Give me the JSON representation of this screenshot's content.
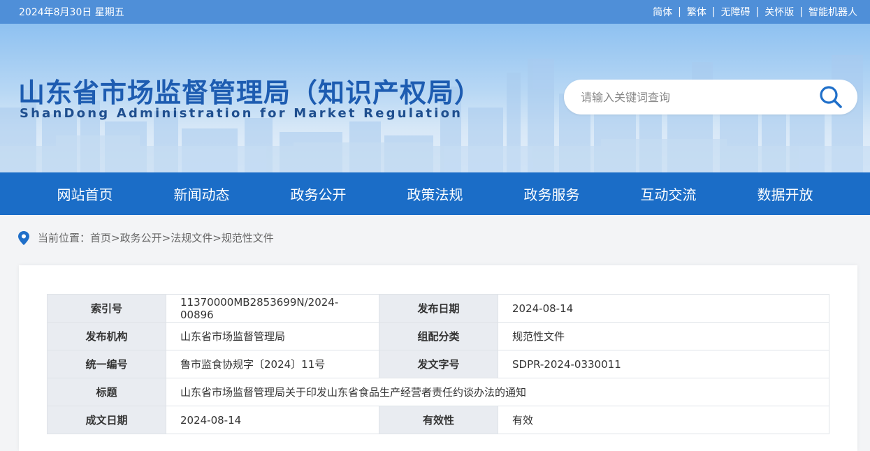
{
  "topbar": {
    "date": "2024年8月30日 星期五",
    "links": [
      "简体",
      "繁体",
      "无障碍",
      "关怀版",
      "智能机器人"
    ],
    "separator": "|"
  },
  "header": {
    "title_cn": "山东省市场监督管理局（知识产权局）",
    "title_en": "ShanDong Administration for Market Regulation",
    "search_placeholder": "请输入关键词查询",
    "search_icon": "search-icon"
  },
  "nav": {
    "items": [
      "网站首页",
      "新闻动态",
      "政务公开",
      "政策法规",
      "政务服务",
      "互动交流",
      "数据开放"
    ]
  },
  "breadcrumb": {
    "prefix": "当前位置：",
    "items": [
      "首页",
      "政务公开",
      "法规文件",
      "规范性文件"
    ],
    "separator": ">"
  },
  "info": {
    "index_label": "索引号",
    "index_value": "11370000MB2853699N/2024-00896",
    "pubdate_label": "发布日期",
    "pubdate_value": "2024-08-14",
    "org_label": "发布机构",
    "org_value": "山东省市场监督管理局",
    "category_label": "组配分类",
    "category_value": "规范性文件",
    "serial_label": "统一编号",
    "serial_value": "鲁市监食协规字〔2024〕11号",
    "docno_label": "发文字号",
    "docno_value": "SDPR-2024-0330011",
    "title_label": "标题",
    "title_value": "山东省市场监督管理局关于印发山东省食品生产经营者责任约谈办法的通知",
    "created_label": "成文日期",
    "created_value": "2024-08-14",
    "validity_label": "有效性",
    "validity_value": "有效"
  },
  "colors": {
    "topbar": "#4f8fd8",
    "nav": "#1b6dc7",
    "title": "#1d5cb1",
    "accent": "#1f6fc9"
  }
}
